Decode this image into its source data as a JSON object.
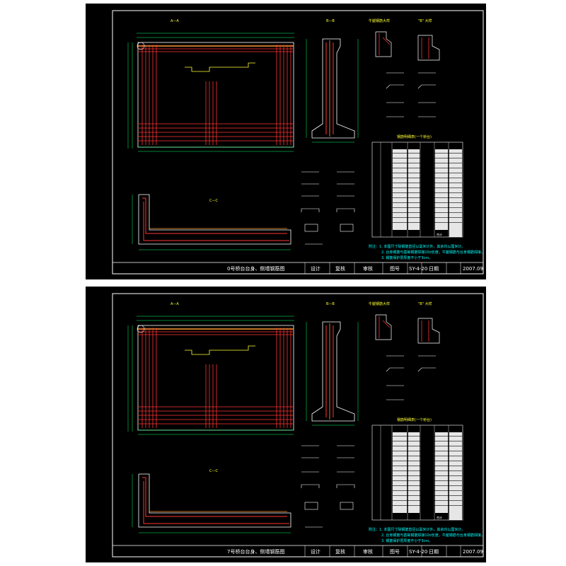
{
  "sheets": [
    {
      "title_block": {
        "drawing_title": "0号桥台台身、侧墙钢筋图",
        "design": "设计",
        "review": "复核",
        "approve": "审核",
        "figure_no_label": "图号",
        "figure_no": "SY-4-20",
        "date_label": "日期",
        "date": "2007.09"
      },
      "views": {
        "elevation": "A—A",
        "section_b": "B—B",
        "section_c": "C—C",
        "detail_a": "牛腿钢筋大样",
        "detail_b": "\"B\" 大样",
        "table_title": "钢筋明细表(一个桥台)"
      },
      "notes": [
        "附注：1. 本图尺寸除钢筋直径以毫米计外，其余均以厘米计。",
        "2. 台身钢筋与基础钢筋焊接10d长度，牛腿钢筋与台身钢筋焊接。",
        "3. 钢筋保护层厚度不小于3cm。"
      ],
      "table_total": "合计"
    },
    {
      "title_block": {
        "drawing_title": "7号桥台台身、侧墙钢筋图",
        "design": "设计",
        "review": "复核",
        "approve": "审核",
        "figure_no_label": "图号",
        "figure_no": "SY-4-20",
        "date_label": "日期",
        "date": "2007.09"
      },
      "views": {
        "elevation": "A—A",
        "section_b": "B—B",
        "section_c": "C—C",
        "detail_a": "牛腿钢筋大样",
        "detail_b": "\"B\" 大样",
        "table_title": "钢筋明细表(一个桥台)"
      },
      "notes": [
        "附注：1. 本图尺寸除钢筋直径以毫米计外，其余均以厘米计。",
        "2. 台身钢筋与基础钢筋焊接10d长度，牛腿钢筋与台身钢筋焊接。",
        "3. 钢筋保护层厚度不小于3cm。"
      ],
      "table_total": "合计"
    }
  ],
  "colors": {
    "background": "#000000",
    "frame": "#ffffff",
    "rebar_main": "#ff3333",
    "rebar_accent": "#ff9933",
    "dimension": "#00ff66",
    "outline": "#ffffff",
    "highlight": "#ffff33",
    "text_label": "#00ffff",
    "table_fill": "#ffffff"
  }
}
